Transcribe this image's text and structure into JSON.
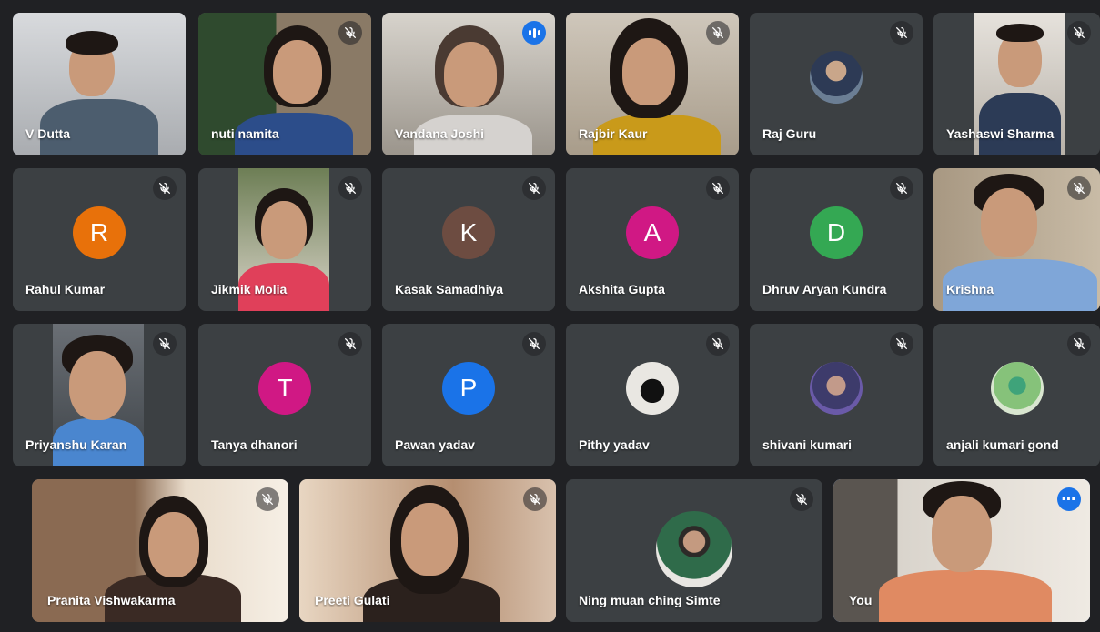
{
  "participants": [
    {
      "name": "V Dutta",
      "state": "video"
    },
    {
      "name": "nuti namita",
      "state": "muted"
    },
    {
      "name": "Vandana Joshi",
      "state": "speaking"
    },
    {
      "name": "Rajbir Kaur",
      "state": "muted"
    },
    {
      "name": "Raj Guru",
      "state": "muted"
    },
    {
      "name": "Yashaswi Sharma",
      "state": "muted"
    },
    {
      "name": "Rahul Kumar",
      "initial": "R",
      "color": "#e8710a"
    },
    {
      "name": "Jikmik Molia",
      "state": "muted"
    },
    {
      "name": "Kasak Samadhiya",
      "initial": "K",
      "color": "#6d4c41"
    },
    {
      "name": "Akshita Gupta",
      "initial": "A",
      "color": "#d01884"
    },
    {
      "name": "Dhruv Aryan Kundra",
      "initial": "D",
      "color": "#34a853"
    },
    {
      "name": "Krishna",
      "state": "muted"
    },
    {
      "name": "Priyanshu Karan",
      "state": "muted"
    },
    {
      "name": "Tanya dhanori",
      "initial": "T",
      "color": "#d01884"
    },
    {
      "name": "Pawan yadav",
      "initial": "P",
      "color": "#1a73e8"
    },
    {
      "name": "Pithy yadav",
      "state": "muted"
    },
    {
      "name": "shivani kumari",
      "state": "muted"
    },
    {
      "name": "anjali kumari gond",
      "state": "muted"
    },
    {
      "name": "Pranita Vishwakarma",
      "state": "muted"
    },
    {
      "name": "Preeti Gulati",
      "state": "muted"
    },
    {
      "name": "Ning muan ching Simte",
      "state": "muted"
    },
    {
      "name": "You",
      "state": "self"
    }
  ]
}
